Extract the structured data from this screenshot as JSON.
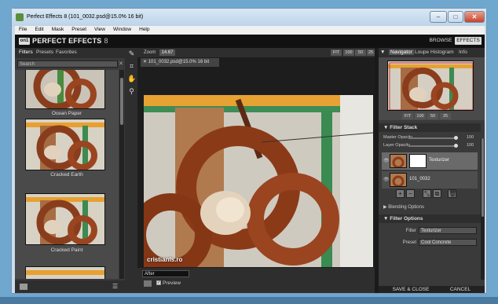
{
  "window": {
    "title": "Perfect Effects 8 (101_0032.psd@15.0% 16 bit)",
    "min_label": "–",
    "max_label": "□",
    "close_label": "✕"
  },
  "menu": [
    "File",
    "Edit",
    "Mask",
    "Preset",
    "View",
    "Window",
    "Help"
  ],
  "header": {
    "logo_badge": "on1",
    "logo_text": "PERFECT EFFECTS",
    "logo_version": "8",
    "browse_label": "BROWSE",
    "effects_label": "EFFECTS"
  },
  "left_panel": {
    "tabs": [
      "Filters",
      "Presets",
      "Favorites"
    ],
    "search_placeholder": "Search",
    "search_clear": "✕",
    "thumbnails": [
      "Ocean Paper",
      "Cracked Earth",
      "Cracked Paint"
    ]
  },
  "center": {
    "zoom_label": "Zoom",
    "zoom_value": "14.67",
    "fit_buttons": [
      "FIT",
      "100",
      "50",
      "25"
    ],
    "doc_tab": "101_0032.psd@15.0% 16 bit",
    "doc_tab_close": "✕",
    "watermark": "cristianls.ro",
    "view_mode": "After",
    "preview_label": "Preview"
  },
  "right_panel": {
    "tabs": [
      "Navigator",
      "Loupe",
      "Histogram",
      "Info"
    ],
    "nav_buttons": [
      "FIT",
      "100",
      "50",
      "25"
    ],
    "filter_stack": {
      "title": "Filter Stack",
      "master_opacity_label": "Master Opacity",
      "master_opacity": "100",
      "master_opacity_fraction": 1.0,
      "layer_opacity_label": "Layer Opacity",
      "layer_opacity": "100",
      "layer_opacity_fraction": 1.0,
      "layers": [
        {
          "name": "Texturizer",
          "selected": true
        },
        {
          "name": "101_0032",
          "selected": false
        }
      ]
    },
    "blending_options": "Blending Options",
    "filter_options": {
      "title": "Filter Options",
      "filter_label": "Filter",
      "filter_value": "Texturizer",
      "preset_label": "Preset",
      "preset_value": "Cool Concrete"
    },
    "save_close": "SAVE & CLOSE",
    "cancel": "CANCEL"
  }
}
